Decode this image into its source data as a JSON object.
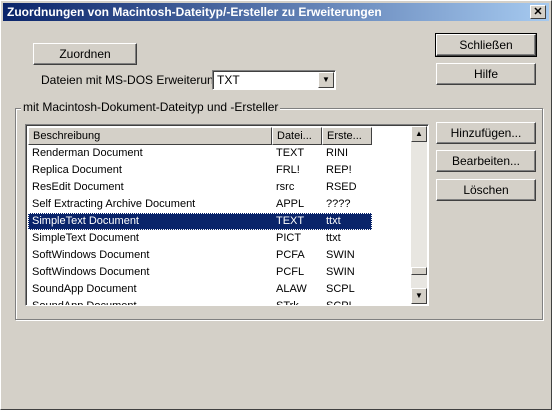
{
  "window": {
    "title": "Zuordnungen von Macintosh-Dateityp/-Ersteller zu Erweiterungen",
    "close_glyph": "✕"
  },
  "buttons": {
    "assign": "Zuordnen",
    "close": "Schließen",
    "help": "Hilfe",
    "add": "Hinzufügen...",
    "edit": "Bearbeiten...",
    "delete": "Löschen"
  },
  "extension": {
    "label": "Dateien mit MS-DOS Erweiterung:",
    "value": "TXT"
  },
  "group": {
    "label": "mit Macintosh-Dokument-Dateityp und -Ersteller"
  },
  "table": {
    "columns": [
      "Beschreibung",
      "Datei...",
      "Erste..."
    ],
    "rows": [
      {
        "desc": "Renderman Document",
        "type": "TEXT",
        "creator": "RINI"
      },
      {
        "desc": "Replica Document",
        "type": "FRL!",
        "creator": "REP!"
      },
      {
        "desc": "ResEdit Document",
        "type": "rsrc",
        "creator": "RSED"
      },
      {
        "desc": "Self Extracting Archive Document",
        "type": "APPL",
        "creator": "????"
      },
      {
        "desc": "SimpleText Document",
        "type": "TEXT",
        "creator": "ttxt"
      },
      {
        "desc": "SimpleText Document",
        "type": "PICT",
        "creator": "ttxt"
      },
      {
        "desc": "SoftWindows Document",
        "type": "PCFA",
        "creator": "SWIN"
      },
      {
        "desc": "SoftWindows Document",
        "type": "PCFL",
        "creator": "SWIN"
      },
      {
        "desc": "SoundApp Document",
        "type": "ALAW",
        "creator": "SCPL"
      },
      {
        "desc": "SoundApp Document",
        "type": "STrk",
        "creator": "SCPL"
      }
    ],
    "selected_index": 4
  }
}
